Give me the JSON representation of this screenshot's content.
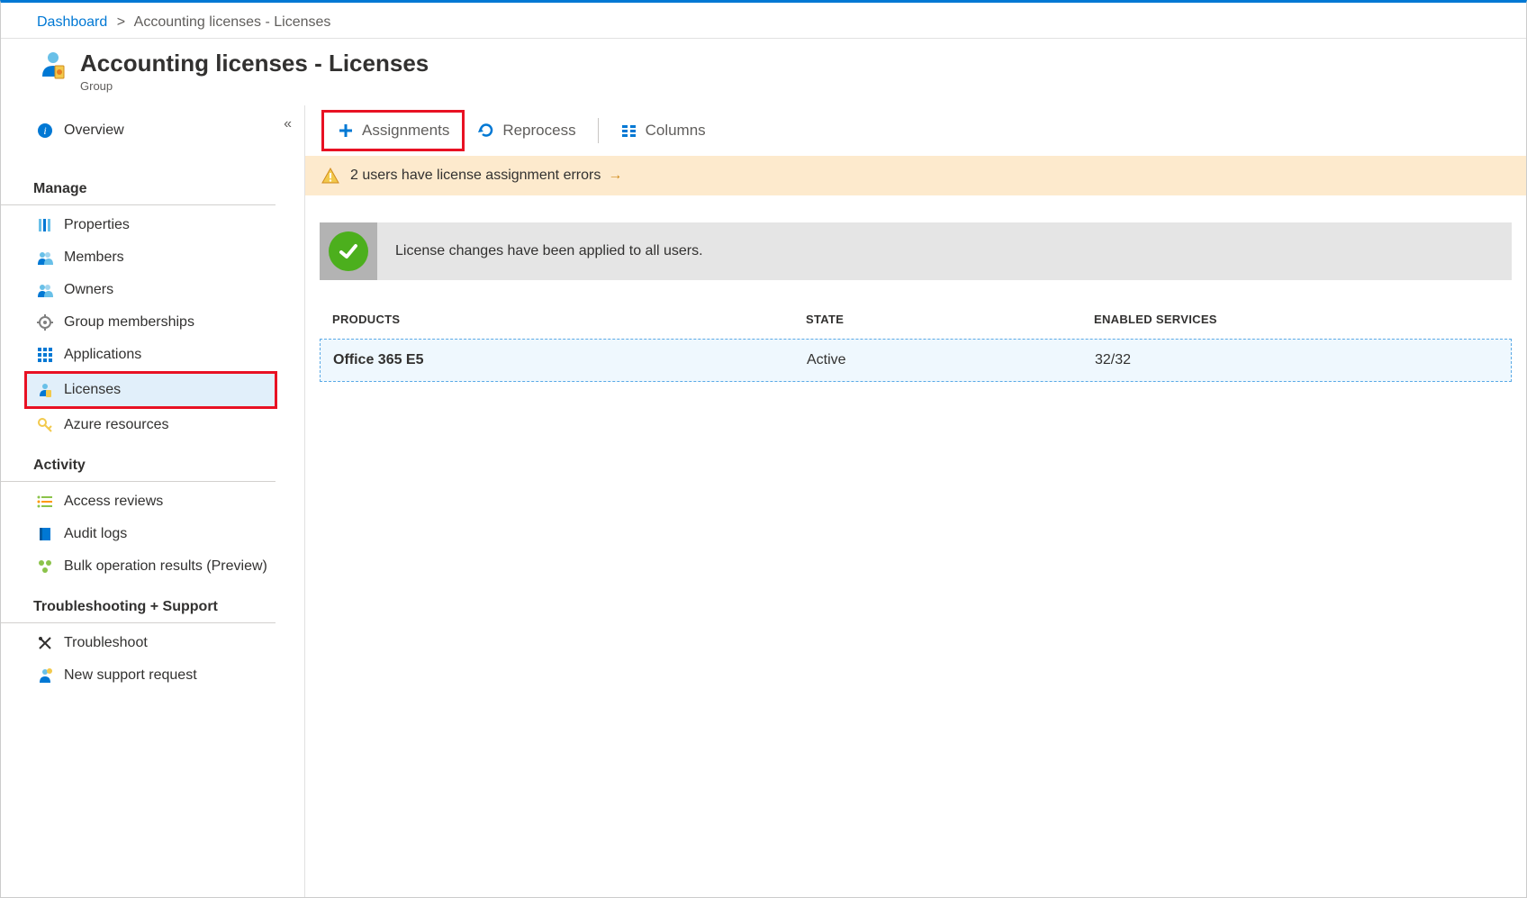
{
  "breadcrumb": {
    "root": "Dashboard",
    "current": "Accounting licenses - Licenses"
  },
  "header": {
    "title": "Accounting licenses - Licenses",
    "subtitle": "Group"
  },
  "sidebar": {
    "overview": "Overview",
    "sections": {
      "manage": "Manage",
      "activity": "Activity",
      "support": "Troubleshooting + Support"
    },
    "items": {
      "properties": "Properties",
      "members": "Members",
      "owners": "Owners",
      "groupMemberships": "Group memberships",
      "applications": "Applications",
      "licenses": "Licenses",
      "azureResources": "Azure resources",
      "accessReviews": "Access reviews",
      "auditLogs": "Audit logs",
      "bulkOps": "Bulk operation results (Preview)",
      "troubleshoot": "Troubleshoot",
      "newSupport": "New support request"
    }
  },
  "toolbar": {
    "assignments": "Assignments",
    "reprocess": "Reprocess",
    "columns": "Columns"
  },
  "warning": {
    "text": "2 users have license assignment errors"
  },
  "status": {
    "message": "License changes have been applied to all users."
  },
  "table": {
    "headers": {
      "products": "PRODUCTS",
      "state": "STATE",
      "enabled": "ENABLED SERVICES"
    },
    "rows": [
      {
        "product": "Office 365 E5",
        "state": "Active",
        "enabled": "32/32"
      }
    ]
  }
}
